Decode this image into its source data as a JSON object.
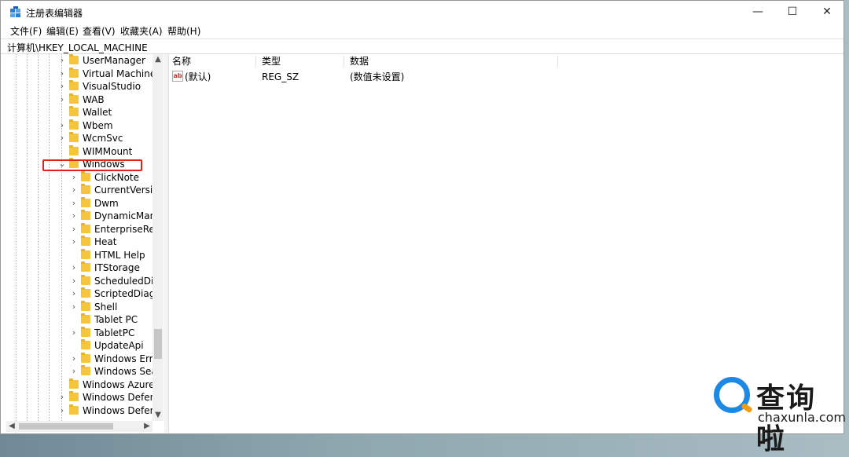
{
  "window": {
    "title": "注册表编辑器",
    "controls": {
      "minimize": "—",
      "maximize": "☐",
      "close": "✕"
    }
  },
  "menu": [
    "文件(F)",
    "编辑(E)",
    "查看(V)",
    "收藏夹(A)",
    "帮助(H)"
  ],
  "address": "计算机\\HKEY_LOCAL_MACHINE",
  "tree": {
    "items": [
      {
        "label": "UserManager",
        "level": 1,
        "expander": "›"
      },
      {
        "label": "Virtual Machine",
        "level": 1,
        "expander": "›"
      },
      {
        "label": "VisualStudio",
        "level": 1,
        "expander": "›"
      },
      {
        "label": "WAB",
        "level": 1,
        "expander": "›"
      },
      {
        "label": "Wallet",
        "level": 1,
        "expander": ""
      },
      {
        "label": "Wbem",
        "level": 1,
        "expander": "›"
      },
      {
        "label": "WcmSvc",
        "level": 1,
        "expander": "›"
      },
      {
        "label": "WIMMount",
        "level": 1,
        "expander": ""
      },
      {
        "label": "Windows",
        "level": 1,
        "expander": "⌄",
        "highlighted": true
      },
      {
        "label": "ClickNote",
        "level": 2,
        "expander": "›"
      },
      {
        "label": "CurrentVersic",
        "level": 2,
        "expander": "›"
      },
      {
        "label": "Dwm",
        "level": 2,
        "expander": "›"
      },
      {
        "label": "DynamicMana",
        "level": 2,
        "expander": "›"
      },
      {
        "label": "EnterpriseRes",
        "level": 2,
        "expander": "›"
      },
      {
        "label": "Heat",
        "level": 2,
        "expander": "›"
      },
      {
        "label": "HTML Help",
        "level": 2,
        "expander": ""
      },
      {
        "label": "ITStorage",
        "level": 2,
        "expander": "›"
      },
      {
        "label": "ScheduledDia",
        "level": 2,
        "expander": "›"
      },
      {
        "label": "ScriptedDiagi",
        "level": 2,
        "expander": "›"
      },
      {
        "label": "Shell",
        "level": 2,
        "expander": "›"
      },
      {
        "label": "Tablet PC",
        "level": 2,
        "expander": ""
      },
      {
        "label": "TabletPC",
        "level": 2,
        "expander": "›"
      },
      {
        "label": "UpdateApi",
        "level": 2,
        "expander": ""
      },
      {
        "label": "Windows Erro",
        "level": 2,
        "expander": "›"
      },
      {
        "label": "Windows Sea",
        "level": 2,
        "expander": "›"
      },
      {
        "label": "Windows Azure",
        "level": 1,
        "expander": ""
      },
      {
        "label": "Windows Defen",
        "level": 1,
        "expander": "›"
      },
      {
        "label": "Windows Defen",
        "level": 1,
        "expander": "›"
      }
    ]
  },
  "list": {
    "columns": [
      "名称",
      "类型",
      "数据"
    ],
    "rows": [
      {
        "icon": "ab",
        "name": "(默认)",
        "type": "REG_SZ",
        "data": "(数值未设置)"
      }
    ]
  },
  "watermark": {
    "cn": "查询啦",
    "en": "chaxunla.com"
  },
  "colors": {
    "folder": "#f5c53d",
    "highlight": "#e2231a",
    "watermark_blue": "#1e88e5",
    "watermark_orange": "#f39c12"
  }
}
